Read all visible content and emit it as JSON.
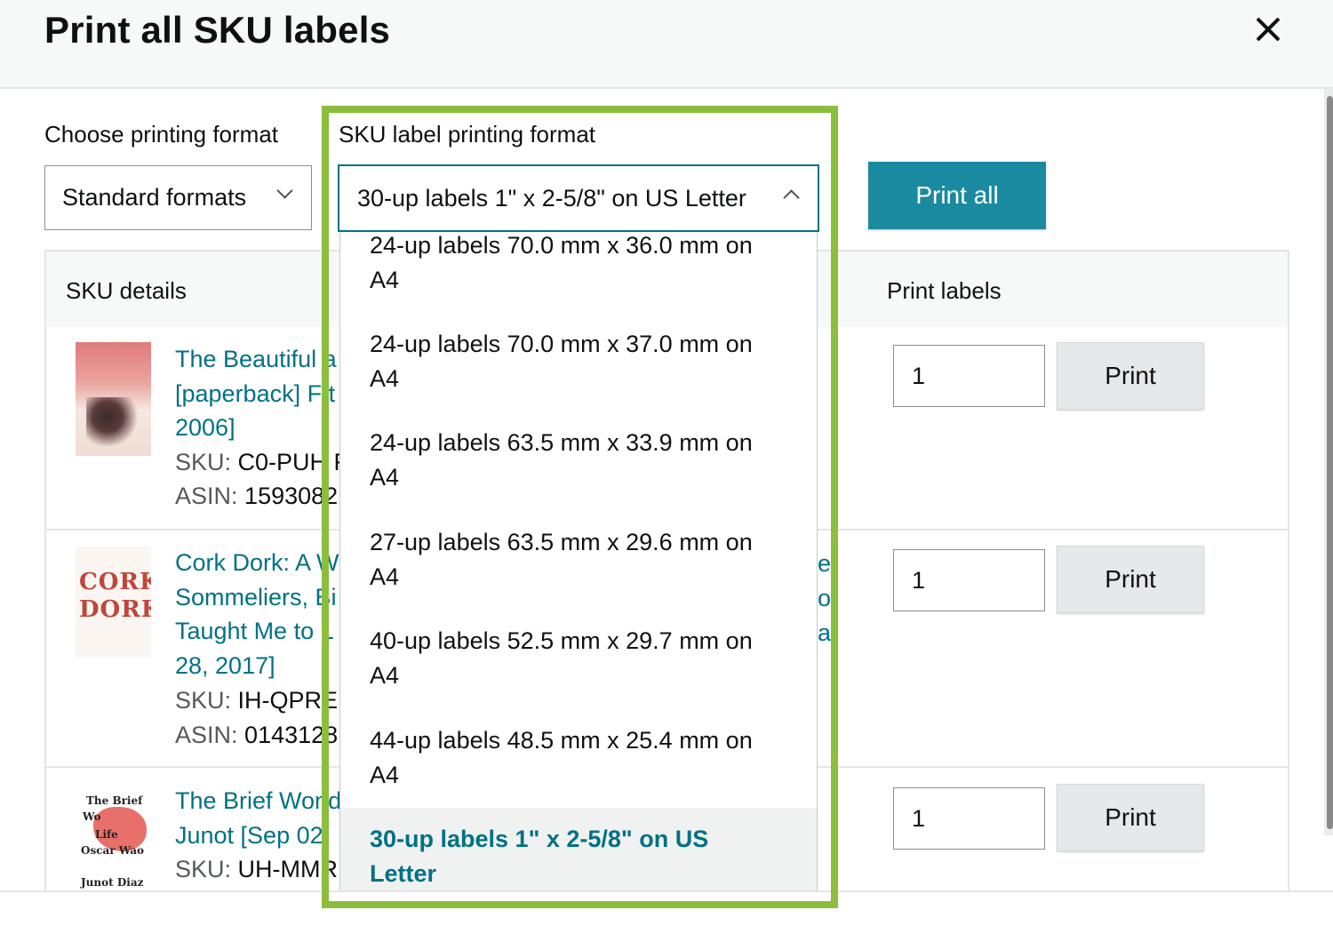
{
  "header": {
    "title": "Print all SKU labels"
  },
  "controls": {
    "choose_label": "Choose printing format",
    "standard_select_value": "Standard formats",
    "sku_format_label": "SKU label printing format",
    "sku_format_value": "30-up labels 1\" x 2-5/8\" on US Letter",
    "print_all_label": "Print all"
  },
  "dropdown": {
    "options": [
      {
        "line1": "24-up labels 70.0 mm x 36.0 mm on",
        "line2": "A4"
      },
      {
        "line1": "24-up labels 70.0 mm x 37.0 mm on",
        "line2": "A4"
      },
      {
        "line1": "24-up labels 63.5 mm x 33.9 mm on",
        "line2": "A4"
      },
      {
        "line1": "27-up labels 63.5 mm x 29.6 mm on",
        "line2": "A4"
      },
      {
        "line1": "40-up labels 52.5 mm x 29.7 mm on",
        "line2": "A4"
      },
      {
        "line1": "44-up labels 48.5 mm x 25.4 mm on",
        "line2": "A4"
      }
    ],
    "selected": {
      "line1": "30-up labels 1\" x 2-5/8\" on US",
      "line2": "Letter"
    }
  },
  "table": {
    "col_sku_details": "SKU details",
    "col_print_labels": "Print labels",
    "rows": [
      {
        "title_lines": [
          "The Beautiful a",
          "[paperback] F t",
          "2006]"
        ],
        "sku_label": "SKU:",
        "sku_value": "C0-PUH F",
        "asin_label": "ASIN:",
        "asin_value": "1593082",
        "quantity": "1",
        "print_label": "Print"
      },
      {
        "title_lines": [
          "Cork Dork: A W",
          "Sommeliers, Bi",
          "Taught Me to L",
          "28, 2017]"
        ],
        "peek_lines": [
          "e",
          "o",
          "a"
        ],
        "sku_label": "SKU:",
        "sku_value": "IH-QPRE",
        "asin_label": "ASIN:",
        "asin_value": "0143128",
        "quantity": "1",
        "print_label": "Print"
      },
      {
        "title_lines": [
          "The Brief Wond",
          "Junot [Sep 02,"
        ],
        "sku_label": "SKU:",
        "sku_value": "UH-MMR",
        "quantity": "1",
        "print_label": "Print"
      }
    ]
  },
  "thumbnails": {
    "cork_text": [
      "CORK",
      "DORK"
    ],
    "brief_text": [
      "The Brief",
      "Wo",
      "Life",
      "Oscar Wao",
      "Junot Diaz"
    ]
  },
  "colors": {
    "accent": "#007185",
    "primary_button": "#1a8aa0",
    "highlight_border": "#8bbe3c"
  }
}
